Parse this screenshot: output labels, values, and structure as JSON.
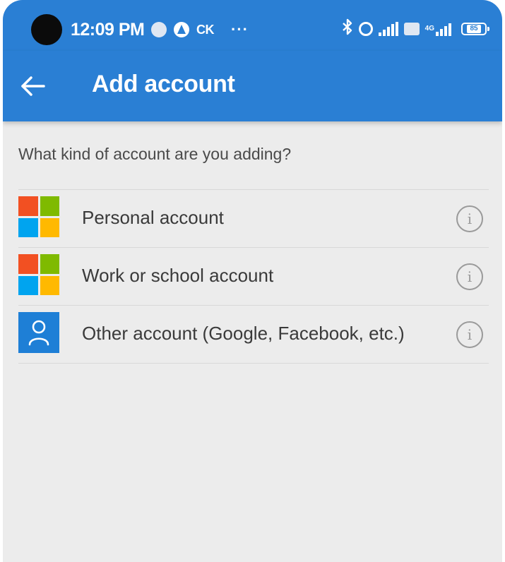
{
  "status_bar": {
    "time": "12:09 PM",
    "carrier_text": "CK",
    "more_indicator": "···",
    "network_label": "4G",
    "battery_level": "85",
    "icons": [
      "camera-cutout",
      "circle-notification-icon",
      "navigation-icon",
      "bluetooth-icon",
      "alarm-icon",
      "signal-icon",
      "volte-icon",
      "signal-icon",
      "battery-icon"
    ]
  },
  "app_bar": {
    "back_icon": "arrow-left-icon",
    "title": "Add account",
    "background_color": "#2a7fd4"
  },
  "content": {
    "prompt": "What kind of account are you adding?",
    "options": [
      {
        "label": "Personal account",
        "icon": "microsoft-logo-icon",
        "info_icon": "info-icon"
      },
      {
        "label": "Work or school account",
        "icon": "microsoft-logo-icon",
        "info_icon": "info-icon"
      },
      {
        "label": "Other account (Google, Facebook, etc.)",
        "icon": "person-icon",
        "info_icon": "info-icon"
      }
    ]
  }
}
